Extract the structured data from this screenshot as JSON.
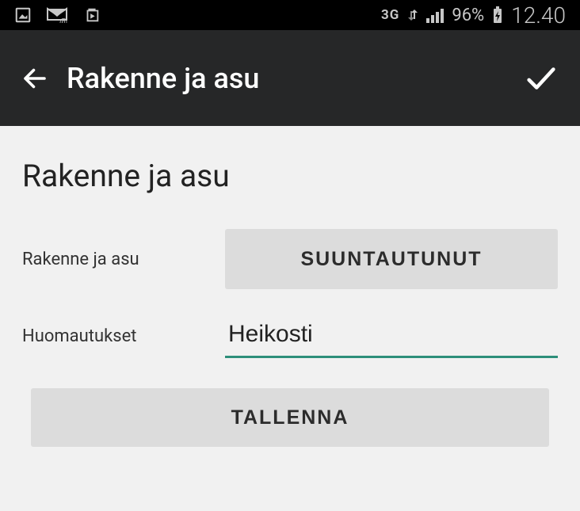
{
  "status": {
    "network": "3G",
    "battery_pct": "96%",
    "time": "12.40"
  },
  "appbar": {
    "title": "Rakenne ja asu"
  },
  "page": {
    "title": "Rakenne ja asu"
  },
  "form": {
    "field1": {
      "label": "Rakenne ja asu",
      "value": "SUUNTAUTUNUT"
    },
    "field2": {
      "label": "Huomautukset",
      "value": "Heikosti"
    },
    "save_label": "TALLENNA"
  }
}
